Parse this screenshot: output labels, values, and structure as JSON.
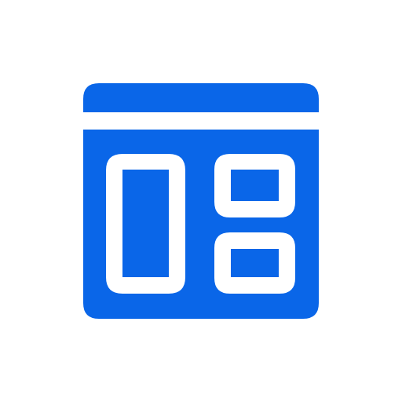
{
  "icon": {
    "name": "dashboard-layout-icon",
    "color": "#0a66e8",
    "background": "#ffffff"
  }
}
